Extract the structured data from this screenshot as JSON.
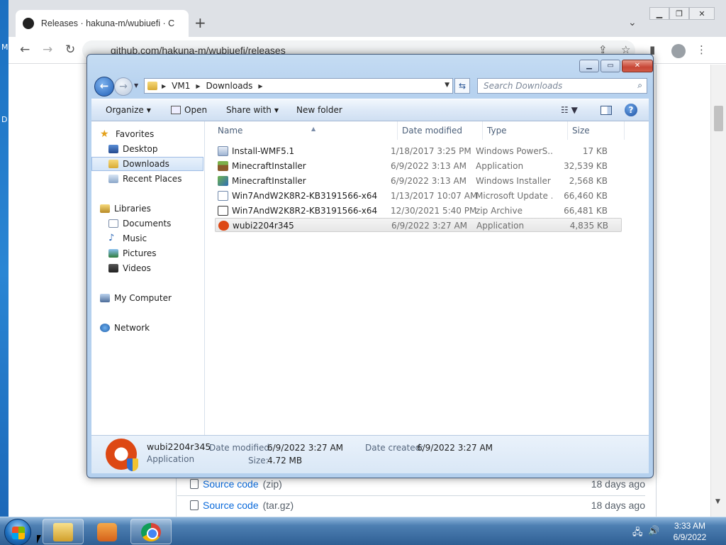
{
  "desktop": {
    "edge_top": "M",
    "edge_mid": "D"
  },
  "chrome": {
    "tab_title": "Releases · hakuna-m/wubiuefi · C",
    "url": "github.com/hakuna-m/wubiuefi/releases",
    "assets": [
      {
        "name": "Source code",
        "kind": "(zip)",
        "age": "18 days ago"
      },
      {
        "name": "Source code",
        "kind": "(tar.gz)",
        "age": "18 days ago"
      }
    ]
  },
  "explorer": {
    "breadcrumb": [
      "VM1",
      "Downloads"
    ],
    "search_placeholder": "Search Downloads",
    "commands": {
      "organize": "Organize",
      "open": "Open",
      "share_with": "Share with",
      "new_folder": "New folder"
    },
    "nav": {
      "favorites": "Favorites",
      "desktop": "Desktop",
      "downloads": "Downloads",
      "recent_places": "Recent Places",
      "libraries": "Libraries",
      "documents": "Documents",
      "music": "Music",
      "pictures": "Pictures",
      "videos": "Videos",
      "my_computer": "My Computer",
      "network": "Network"
    },
    "columns": {
      "name": "Name",
      "date": "Date modified",
      "type": "Type",
      "size": "Size"
    },
    "files": [
      {
        "name": "Install-WMF5.1",
        "date": "1/18/2017 3:25 PM",
        "type": "Windows PowerS...",
        "size": "17 KB",
        "icon": "powershell-script-icon"
      },
      {
        "name": "MinecraftInstaller",
        "date": "6/9/2022 3:13 AM",
        "type": "Application",
        "size": "32,539 KB",
        "icon": "minecraft-icon"
      },
      {
        "name": "MinecraftInstaller",
        "date": "6/9/2022 3:13 AM",
        "type": "Windows Installer ...",
        "size": "2,568 KB",
        "icon": "msi-installer-icon"
      },
      {
        "name": "Win7AndW2K8R2-KB3191566-x64",
        "date": "1/13/2017 10:07 AM",
        "type": "Microsoft Update ...",
        "size": "66,460 KB",
        "icon": "msu-update-icon"
      },
      {
        "name": "Win7AndW2K8R2-KB3191566-x64",
        "date": "12/30/2021 5:40 PM",
        "type": "zip Archive",
        "size": "66,481 KB",
        "icon": "zip-archive-icon"
      },
      {
        "name": "wubi2204r345",
        "date": "6/9/2022 3:27 AM",
        "type": "Application",
        "size": "4,835 KB",
        "icon": "ubuntu-icon"
      }
    ],
    "details": {
      "name": "wubi2204r345",
      "kind": "Application",
      "modified_label": "Date modified:",
      "modified": "6/9/2022 3:27 AM",
      "created_label": "Date created:",
      "created": "6/9/2022 3:27 AM",
      "size_label": "Size:",
      "size": "4.72 MB"
    }
  },
  "taskbar": {
    "time": "3:33 AM",
    "date": "6/9/2022"
  }
}
